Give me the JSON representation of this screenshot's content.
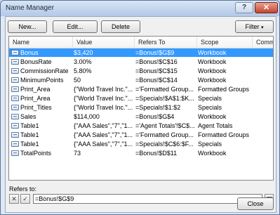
{
  "window": {
    "title": "Name Manager",
    "help_label": "?",
    "close_label": "✕"
  },
  "toolbar": {
    "new_label": "New...",
    "edit_label": "Edit...",
    "delete_label": "Delete",
    "filter_label": "Filter"
  },
  "list": {
    "columns": [
      "Name",
      "Value",
      "Refers To",
      "Scope",
      "Commer"
    ],
    "rows": [
      {
        "name": "Bonus",
        "value": "$3,420",
        "refers_to": "=Bonus!$G$9",
        "scope": "Workbook",
        "selected": true
      },
      {
        "name": "BonusRate",
        "value": "3.00%",
        "refers_to": "=Bonus!$C$16",
        "scope": "Workbook"
      },
      {
        "name": "CommissionRate",
        "value": "5.80%",
        "refers_to": "=Bonus!$C$15",
        "scope": "Workbook"
      },
      {
        "name": "MinimumPoints",
        "value": "50",
        "refers_to": "=Bonus!$C$14",
        "scope": "Workbook"
      },
      {
        "name": "Print_Area",
        "value": "{\"World Travel Inc.\"...",
        "refers_to": "='Formatted Group...",
        "scope": "Formatted Groups"
      },
      {
        "name": "Print_Area",
        "value": "{\"World Travel Inc.\"...",
        "refers_to": "=Specials!$A$1:$K...",
        "scope": "Specials"
      },
      {
        "name": "Print_Titles",
        "value": "{\"World Travel Inc.\"...",
        "refers_to": "=Specials!$1:$2",
        "scope": "Specials"
      },
      {
        "name": "Sales",
        "value": "$114,000",
        "refers_to": "=Bonus!$G$4",
        "scope": "Workbook"
      },
      {
        "name": "Table1",
        "value": "{\"AAA Sales\",\"7\",\"1...",
        "refers_to": "='Agent Totals'!$C$...",
        "scope": "Agent Totals"
      },
      {
        "name": "Table1",
        "value": "{\"AAA Sales\",\"7\",\"1...",
        "refers_to": "='Formatted Group...",
        "scope": "Formatted Groups"
      },
      {
        "name": "Table1",
        "value": "{\"AAA Sales\",\"7\",\"1...",
        "refers_to": "=Specials!$C$6:$F...",
        "scope": "Specials"
      },
      {
        "name": "TotalPoints",
        "value": "73",
        "refers_to": "=Bonus!$D$11",
        "scope": "Workbook"
      }
    ]
  },
  "refers": {
    "label": "Refers to:",
    "value": "=Bonus!$G$9",
    "cancel_symbol": "✕",
    "accept_symbol": "✓"
  },
  "footer": {
    "close_label": "Close"
  }
}
